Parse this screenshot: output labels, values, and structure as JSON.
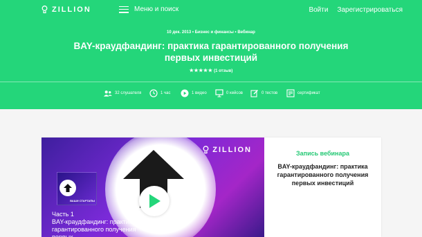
{
  "header": {
    "logo_text": "ZILLION",
    "menu_label": "Меню и поиск",
    "login_label": "Войти",
    "register_label": "Зарегистрироваться"
  },
  "course": {
    "date": "10 дек. 2013",
    "category": "Бизнес и финансы",
    "format": "Вебинар",
    "title": "BAY-краудфандинг: практика гарантированного получения первых инвестиций",
    "stars": "★★★★★",
    "reviews": "(1 отзыв)"
  },
  "stats": {
    "listeners": "32 слушателя",
    "duration": "1 час",
    "videos": "1 видео",
    "cases": "0 кейсов",
    "tests": "0 тестов",
    "certificate": "сертификат"
  },
  "video": {
    "logo_text": "ZILLION",
    "thumb_tag": "ВАШИ СТАРТАПЫ",
    "part": "Часть 1",
    "caption": "BAY-краудфандинг: практика гарантированного получения первых"
  },
  "side": {
    "label": "Запись вебинара",
    "title": "BAY-краудфандинг: практика гарантированного получения первых инвестиций"
  },
  "colors": {
    "brand_green": "#24d67a",
    "video_purple": "#7a2ad8"
  }
}
